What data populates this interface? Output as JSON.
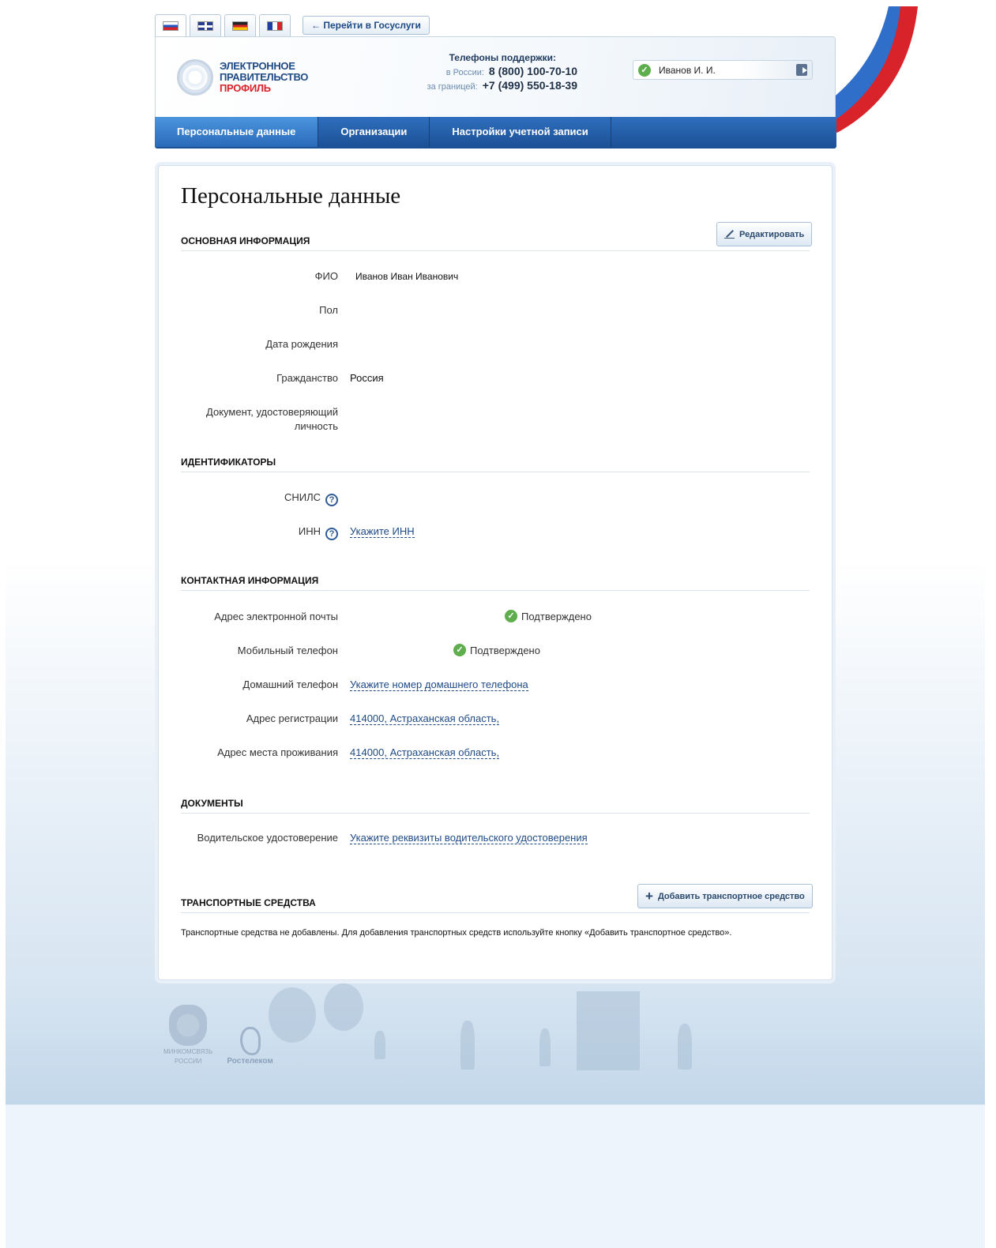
{
  "header": {
    "languages": [
      {
        "name": "Русский",
        "code": "ru"
      },
      {
        "name": "English",
        "code": "uk"
      },
      {
        "name": "Deutsch",
        "code": "de"
      },
      {
        "name": "Français",
        "code": "fr"
      }
    ],
    "gosuslugi_link": "← Перейти в Госуслуги",
    "logo": {
      "line1": "ЭЛЕКТРОННОЕ",
      "line2": "ПРАВИТЕЛЬСТВО",
      "line3": "ПРОФИЛЬ"
    },
    "support": {
      "title": "Телефоны поддержки:",
      "russia_label": "в России:",
      "russia_number": "8 (800) 100-70-10",
      "abroad_label": "за границей:",
      "abroad_number": "+7 (499) 550-18-39"
    },
    "user": {
      "name": "Иванов И. И."
    }
  },
  "nav": {
    "items": [
      {
        "label": "Персональные данные"
      },
      {
        "label": "Организации"
      },
      {
        "label": "Настройки учетной записи"
      }
    ]
  },
  "main": {
    "title": "Персональные данные",
    "edit_button": "Редактировать",
    "basic": {
      "title": "ОСНОВНАЯ ИНФОРМАЦИЯ",
      "fio_label": "ФИО",
      "fio_value": "Иванов Иван Иванович",
      "gender_label": "Пол",
      "birth_label": "Дата рождения",
      "citizenship_label": "Гражданство",
      "citizenship_value": "Россия",
      "document_label_1": "Документ, удостоверяющий",
      "document_label_2": "личность"
    },
    "identifiers": {
      "title": "ИДЕНТИФИКАТОРЫ",
      "snils_label": "СНИЛС",
      "inn_label": "ИНН",
      "inn_link": "Укажите ИНН",
      "help_glyph": "?"
    },
    "contacts": {
      "title": "КОНТАКТНАЯ ИНФОРМАЦИЯ",
      "email_label": "Адрес электронной почты",
      "email_status": "Подтверждено",
      "mobile_label": "Мобильный телефон",
      "mobile_status": "Подтверждено",
      "home_phone_label": "Домашний телефон",
      "home_phone_link": "Укажите номер домашнего телефона",
      "reg_address_label": "Адрес регистрации",
      "reg_address_value": "414000, Астраханская область,",
      "live_address_label": "Адрес места проживания",
      "live_address_value": "414000, Астраханская область,"
    },
    "documents": {
      "title": "ДОКУМЕНТЫ",
      "license_label": "Водительское удостоверение",
      "license_link": "Укажите реквизиты водительского удостоверения"
    },
    "vehicles": {
      "title": "ТРАНСПОРТНЫЕ СРЕДСТВА",
      "add_button": "Добавить транспортное средство",
      "note": "Транспортные средства не добавлены. Для добавления транспортных средств используйте кнопку «Добавить транспортное средство»."
    }
  },
  "footer": {
    "ministry": {
      "line1": "МИНКОМСВЯЗЬ",
      "line2": "РОССИИ"
    },
    "rostelecom": "Ростелеком"
  }
}
